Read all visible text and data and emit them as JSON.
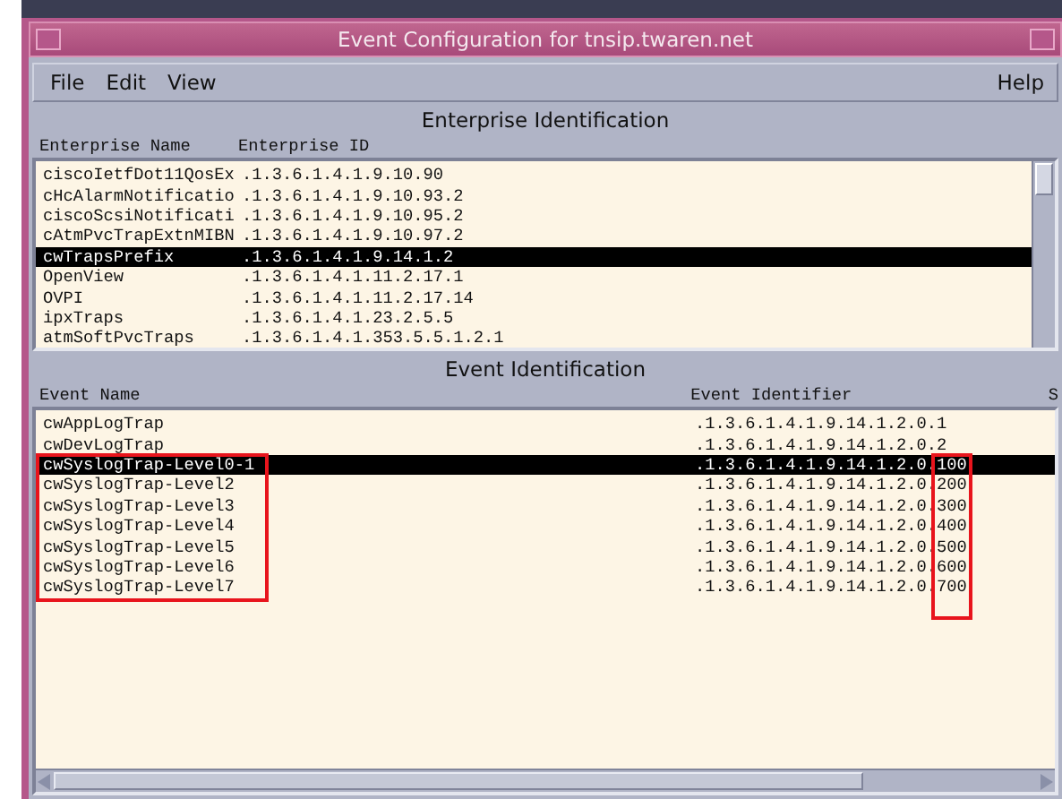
{
  "window": {
    "title": "Event Configuration for tnsip.twaren.net"
  },
  "menu": {
    "items": [
      "File",
      "Edit",
      "View"
    ],
    "help": "Help"
  },
  "enterprise_section": {
    "title": "Enterprise Identification",
    "columns": [
      "Enterprise Name",
      "Enterprise ID"
    ],
    "rows": [
      {
        "name": "ciscoIetfDot11QosEx",
        "id": ".1.3.6.1.4.1.9.10.90",
        "selected": false
      },
      {
        "name": "cHcAlarmNotificatio",
        "id": ".1.3.6.1.4.1.9.10.93.2",
        "selected": false
      },
      {
        "name": "ciscoScsiNotificati",
        "id": ".1.3.6.1.4.1.9.10.95.2",
        "selected": false
      },
      {
        "name": "cAtmPvcTrapExtnMIBN",
        "id": ".1.3.6.1.4.1.9.10.97.2",
        "selected": false
      },
      {
        "name": "cwTrapsPrefix",
        "id": ".1.3.6.1.4.1.9.14.1.2",
        "selected": true
      },
      {
        "name": "OpenView",
        "id": ".1.3.6.1.4.1.11.2.17.1",
        "selected": false
      },
      {
        "name": "OVPI",
        "id": ".1.3.6.1.4.1.11.2.17.14",
        "selected": false
      },
      {
        "name": "ipxTraps",
        "id": ".1.3.6.1.4.1.23.2.5.5",
        "selected": false
      },
      {
        "name": "atmSoftPvcTraps",
        "id": ".1.3.6.1.4.1.353.5.5.1.2.1",
        "selected": false
      }
    ]
  },
  "event_section": {
    "title": "Event Identification",
    "columns": [
      "Event Name",
      "Event Identifier",
      "S"
    ],
    "rows": [
      {
        "name": "cwAppLogTrap",
        "identifier": ".1.3.6.1.4.1.9.14.1.2.0.1",
        "selected": false,
        "marked": false
      },
      {
        "name": "cwDevLogTrap",
        "identifier": ".1.3.6.1.4.1.9.14.1.2.0.2",
        "selected": false,
        "marked": false
      },
      {
        "name": "cwSyslogTrap-Level0-1",
        "identifier": ".1.3.6.1.4.1.9.14.1.2.0.100",
        "selected": true,
        "marked": true
      },
      {
        "name": "cwSyslogTrap-Level2",
        "identifier": ".1.3.6.1.4.1.9.14.1.2.0.200",
        "selected": false,
        "marked": true
      },
      {
        "name": "cwSyslogTrap-Level3",
        "identifier": ".1.3.6.1.4.1.9.14.1.2.0.300",
        "selected": false,
        "marked": true
      },
      {
        "name": "cwSyslogTrap-Level4",
        "identifier": ".1.3.6.1.4.1.9.14.1.2.0.400",
        "selected": false,
        "marked": true
      },
      {
        "name": "cwSyslogTrap-Level5",
        "identifier": ".1.3.6.1.4.1.9.14.1.2.0.500",
        "selected": false,
        "marked": true
      },
      {
        "name": "cwSyslogTrap-Level6",
        "identifier": ".1.3.6.1.4.1.9.14.1.2.0.600",
        "selected": false,
        "marked": true
      },
      {
        "name": "cwSyslogTrap-Level7",
        "identifier": ".1.3.6.1.4.1.9.14.1.2.0.700",
        "selected": false,
        "marked": true
      }
    ]
  }
}
